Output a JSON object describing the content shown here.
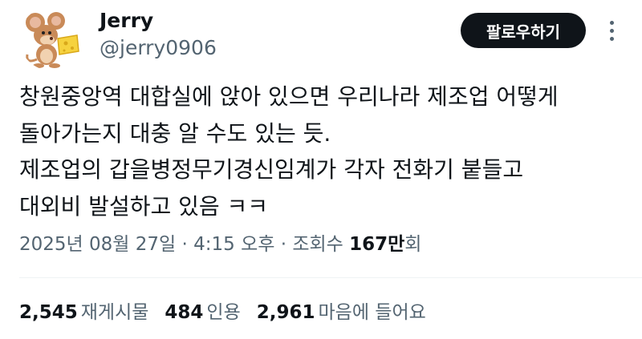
{
  "author": {
    "name": "Jerry",
    "handle": "@jerry0906",
    "avatar_icon": "jerry-mouse-with-cheese-icon"
  },
  "follow_label": "팔로우하기",
  "more_icon": "vertical-ellipsis-icon",
  "body_lines": [
    "창원중앙역 대합실에 앉아 있으면 우리나라 제조업 어떻게",
    "돌아가는지 대충 알 수도 있는 듯.",
    "제조업의 갑을병정무기경신임계가 각자 전화기 붙들고",
    "대외비 발설하고 있음 ㅋㅋ"
  ],
  "meta": {
    "date": "2025년 08월 27일",
    "separator": "·",
    "time": "4:15 오후",
    "views_label": "조회수",
    "views_count": "167만",
    "views_suffix": "회"
  },
  "stats": [
    {
      "count": "2,545",
      "label": "재게시물"
    },
    {
      "count": "484",
      "label": "인용"
    },
    {
      "count": "2,961",
      "label": "마음에 들어요"
    }
  ],
  "colors": {
    "text": "#0f1419",
    "secondary": "#536471",
    "button_bg": "#0f1419",
    "button_text": "#ffffff",
    "divider": "#eff3f4"
  }
}
